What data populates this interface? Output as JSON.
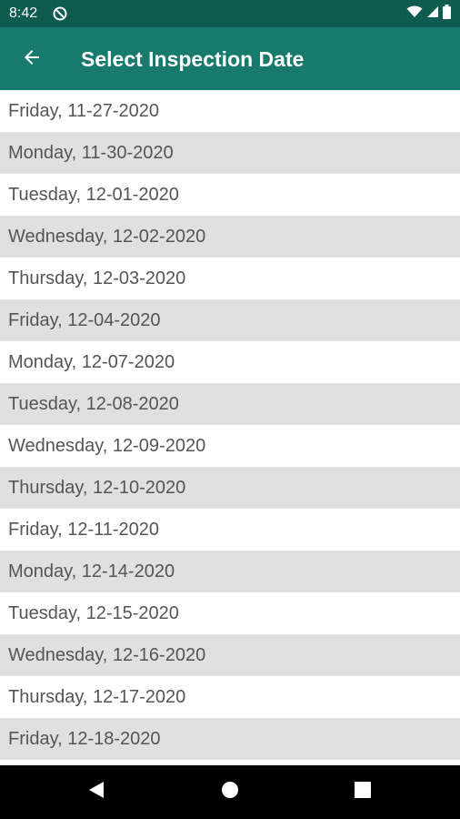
{
  "status_bar": {
    "time": "8:42",
    "icons": [
      "dnd-icon",
      "wifi-icon",
      "signal-icon",
      "battery-icon"
    ]
  },
  "app_bar": {
    "title": "Select Inspection Date",
    "back_icon": "arrow-left-icon"
  },
  "dates": [
    "Friday, 11-27-2020",
    "Monday, 11-30-2020",
    "Tuesday, 12-01-2020",
    "Wednesday, 12-02-2020",
    "Thursday, 12-03-2020",
    "Friday, 12-04-2020",
    "Monday, 12-07-2020",
    "Tuesday, 12-08-2020",
    "Wednesday, 12-09-2020",
    "Thursday, 12-10-2020",
    "Friday, 12-11-2020",
    "Monday, 12-14-2020",
    "Tuesday, 12-15-2020",
    "Wednesday, 12-16-2020",
    "Thursday, 12-17-2020",
    "Friday, 12-18-2020",
    ""
  ],
  "nav_bar": {
    "icons": [
      "back-triangle-icon",
      "home-circle-icon",
      "recents-square-icon"
    ]
  },
  "colors": {
    "status_bar": "#0d5c4f",
    "app_bar": "#177a6c",
    "row_alt": "#e0e0e0",
    "row_plain": "#ffffff",
    "row_text": "#555555"
  }
}
